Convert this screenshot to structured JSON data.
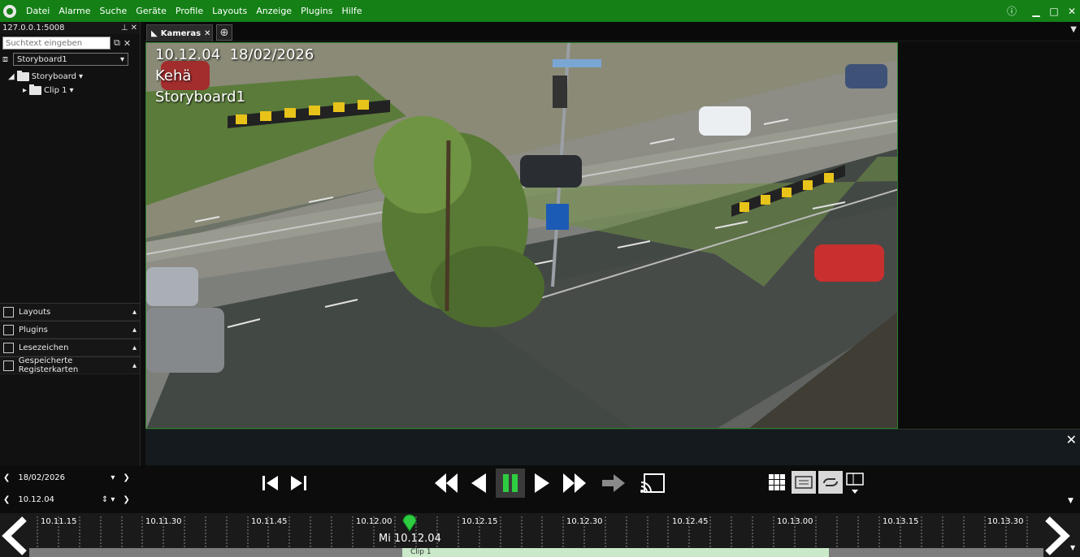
{
  "menubar": {
    "items": [
      "Datei",
      "Alarme",
      "Suche",
      "Geräte",
      "Profile",
      "Layouts",
      "Anzeige",
      "Plugins",
      "Hilfe"
    ]
  },
  "left_panel": {
    "server": "127.0.0.1:5008",
    "search_placeholder": "Suchtext eingeben",
    "storyboard_selected": "Storyboard1",
    "tree": [
      {
        "label": "Storyboard"
      },
      {
        "label": "Clip 1"
      }
    ],
    "accordion": [
      "Layouts",
      "Plugins",
      "Lesezeichen",
      "Gespeicherte Registerkarten"
    ]
  },
  "tabs": [
    {
      "label": "Kameras"
    }
  ],
  "camera": {
    "time": "10.12.04",
    "date": "18/02/2026",
    "name": "Kehä",
    "storyboard": "Storyboard1"
  },
  "playback": {
    "date": "18/02/2026",
    "time": "10.12.04"
  },
  "timeline": {
    "ticks": [
      "10.11.15",
      "10.11.30",
      "10.11.45",
      "10.12.00",
      "10.12.15",
      "10.12.30",
      "10.12.45",
      "10.13.00",
      "10.13.15",
      "10.13.30"
    ],
    "cursor_label": "Mi 10.12.04",
    "clip_label": "Clip 1"
  },
  "colors": {
    "brand": "#148016",
    "clip": "#c9e9c9",
    "marker": "#2ecc40"
  }
}
